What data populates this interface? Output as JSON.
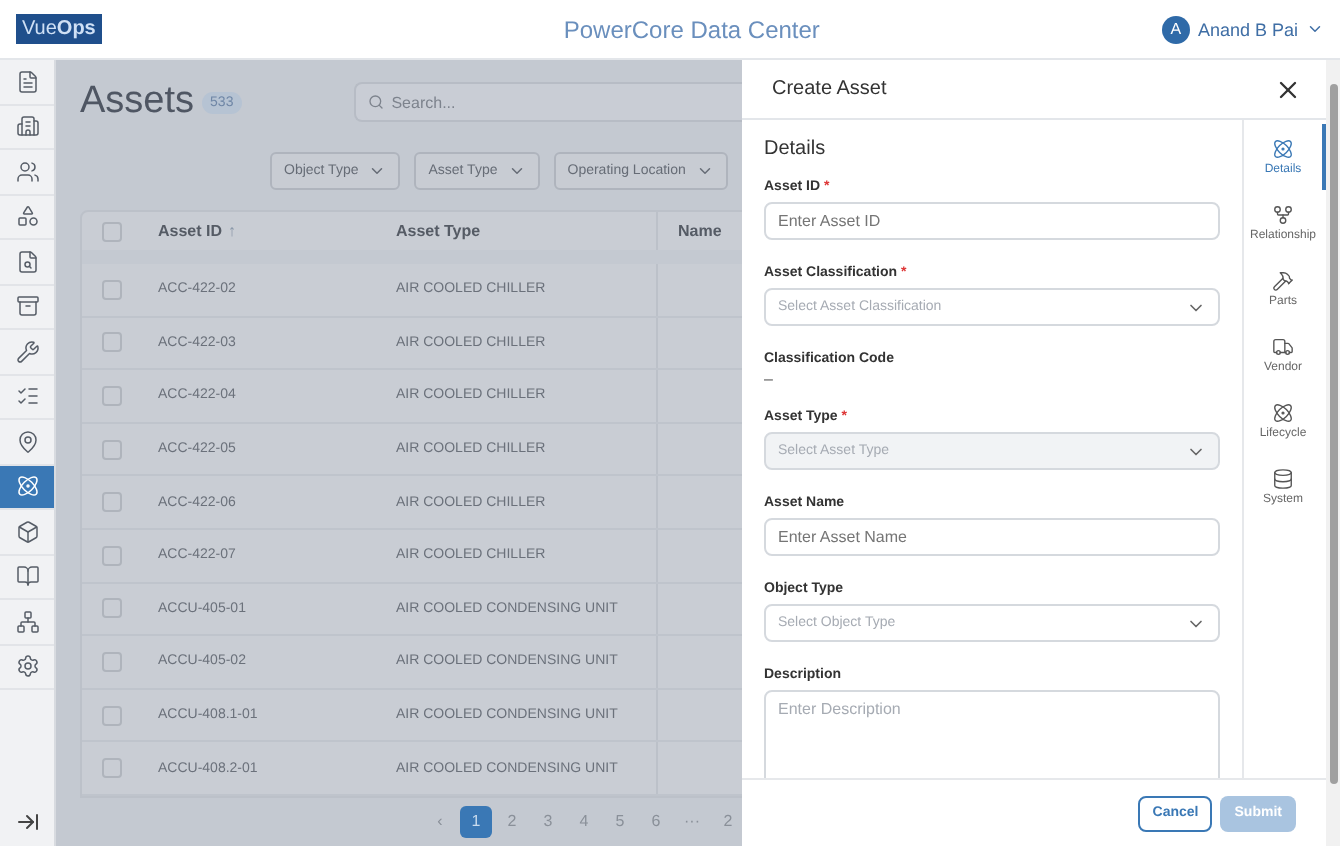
{
  "header": {
    "logo": "Vue**Ops**",
    "title": "PowerCore Data Center",
    "user": {
      "initial": "A",
      "name": "Anand B Pai"
    }
  },
  "sidebar": {
    "items": [
      {
        "kind": "document",
        "selected": false
      },
      {
        "kind": "building",
        "selected": false
      },
      {
        "kind": "people",
        "selected": false
      },
      {
        "kind": "shapes",
        "selected": false
      },
      {
        "kind": "report",
        "selected": false
      },
      {
        "kind": "archive",
        "selected": false
      },
      {
        "kind": "wrench",
        "selected": false
      },
      {
        "kind": "checklist",
        "selected": false
      },
      {
        "kind": "location",
        "selected": false
      },
      {
        "kind": "atom",
        "selected": true
      },
      {
        "kind": "cube",
        "selected": false
      },
      {
        "kind": "book",
        "selected": false
      },
      {
        "kind": "hierarchy",
        "selected": false
      },
      {
        "kind": "settings",
        "selected": false
      }
    ],
    "collapse": true
  },
  "page": {
    "title": "Assets",
    "count": "533",
    "search": {
      "placeholder": "Search..."
    },
    "filters": [
      "Object Type",
      "Asset Type",
      "Operating Location"
    ],
    "table": {
      "columns": [
        "Asset ID",
        "Asset Type",
        "Name"
      ],
      "sort_arrow": "↑",
      "select_all_checked": false,
      "rows": [
        {
          "asset_id": "ACC-422-02",
          "asset_type": "AIR COOLED CHILLER",
          "checked": false
        },
        {
          "asset_id": "ACC-422-03",
          "asset_type": "AIR COOLED CHILLER",
          "checked": false
        },
        {
          "asset_id": "ACC-422-04",
          "asset_type": "AIR COOLED CHILLER",
          "checked": false
        },
        {
          "asset_id": "ACC-422-05",
          "asset_type": "AIR COOLED CHILLER",
          "checked": false
        },
        {
          "asset_id": "ACC-422-06",
          "asset_type": "AIR COOLED CHILLER",
          "checked": false
        },
        {
          "asset_id": "ACC-422-07",
          "asset_type": "AIR COOLED CHILLER",
          "checked": false
        },
        {
          "asset_id": "ACCU-405-01",
          "asset_type": "AIR COOLED CONDENSING UNIT",
          "checked": false
        },
        {
          "asset_id": "ACCU-405-02",
          "asset_type": "AIR COOLED CONDENSING UNIT",
          "checked": false
        },
        {
          "asset_id": "ACCU-408.1-01",
          "asset_type": "AIR COOLED CONDENSING UNIT",
          "checked": false
        },
        {
          "asset_id": "ACCU-408.2-01",
          "asset_type": "AIR COOLED CONDENSING UNIT",
          "checked": false
        }
      ]
    },
    "pagination": {
      "prev": "‹",
      "pages": [
        {
          "label": "1",
          "selected": true
        },
        {
          "label": "2",
          "selected": false
        },
        {
          "label": "3",
          "selected": false
        },
        {
          "label": "4",
          "selected": false
        },
        {
          "label": "5",
          "selected": false
        },
        {
          "label": "6",
          "selected": false
        },
        {
          "label": "···",
          "selected": false
        },
        {
          "label": "2",
          "selected": false
        }
      ]
    }
  },
  "drawer": {
    "title": "Create Asset",
    "section": "Details",
    "required_mark": "*",
    "fields": [
      {
        "kind": "input",
        "label": "Asset ID",
        "required": true,
        "placeholder": "Enter Asset ID",
        "disabled": false
      },
      {
        "kind": "select",
        "label": "Asset Classification",
        "required": true,
        "placeholder": "Select Asset Classification",
        "disabled": false
      },
      {
        "kind": "static",
        "label": "Classification Code",
        "value": "–"
      },
      {
        "kind": "select",
        "label": "Asset Type",
        "required": true,
        "placeholder": "Select Asset Type",
        "disabled": true
      },
      {
        "kind": "input",
        "label": "Asset Name",
        "required": false,
        "placeholder": "Enter Asset Name",
        "disabled": false
      },
      {
        "kind": "select",
        "label": "Object Type",
        "required": false,
        "placeholder": "Select Object Type",
        "disabled": false
      },
      {
        "kind": "textarea",
        "label": "Description",
        "required": false,
        "placeholder": "Enter Description",
        "disabled": false
      }
    ],
    "nav": [
      {
        "kind": "details",
        "label": "Details",
        "selected": true
      },
      {
        "kind": "relationship",
        "label": "Relationship",
        "selected": false
      },
      {
        "kind": "parts",
        "label": "Parts",
        "selected": false
      },
      {
        "kind": "vendor",
        "label": "Vendor",
        "selected": false
      },
      {
        "kind": "lifecycle",
        "label": "Lifecycle",
        "selected": false
      },
      {
        "kind": "system",
        "label": "System",
        "selected": false
      }
    ],
    "buttons": [
      {
        "kind": "secondary",
        "label": "Cancel",
        "disabled": false
      },
      {
        "kind": "primary",
        "label": "Submit",
        "disabled": true
      }
    ]
  }
}
